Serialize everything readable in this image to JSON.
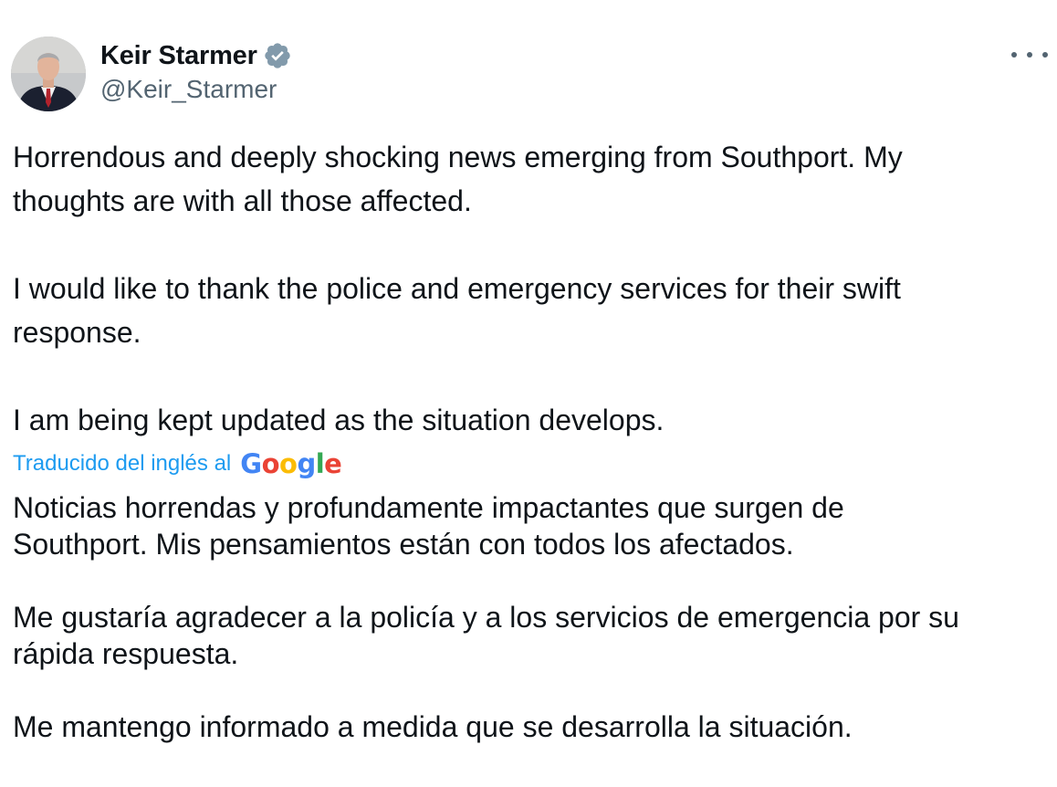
{
  "author": {
    "display_name": "Keir Starmer",
    "handle": "@Keir_Starmer",
    "verified_icon": "verified-badge-icon",
    "avatar_icon": "profile-photo"
  },
  "menu": {
    "icon": "more-options-icon"
  },
  "tweet": {
    "p1_line1": "Horrendous and deeply shocking news emerging from Southport. My",
    "p1_line2": "thoughts are with all those affected.",
    "p2_line1": "I would like to thank the police and emergency services for their swift",
    "p2_line2": "response.",
    "p3_line1": "I am being kept updated as the situation develops."
  },
  "translation_bar": {
    "label": "Traducido del inglés al",
    "provider_letters": [
      "G",
      "o",
      "o",
      "g",
      "l",
      "e"
    ],
    "provider_colors": [
      "#4285F4",
      "#EA4335",
      "#FBBC05",
      "#4285F4",
      "#34A853",
      "#EA4335"
    ]
  },
  "translation": {
    "p1_line1": "Noticias horrendas y profundamente impactantes que surgen de",
    "p1_line2": "Southport. Mis pensamientos están con todos los afectados.",
    "p2_line1": "Me gustaría agradecer a la policía y a los servicios de emergencia por su",
    "p2_line2": "rápida respuesta.",
    "p3_line1": "Me mantengo informado a medida que se desarrolla la situación."
  },
  "colors": {
    "text": "#0f1419",
    "secondary": "#536471",
    "accent": "#1d9bf0"
  }
}
